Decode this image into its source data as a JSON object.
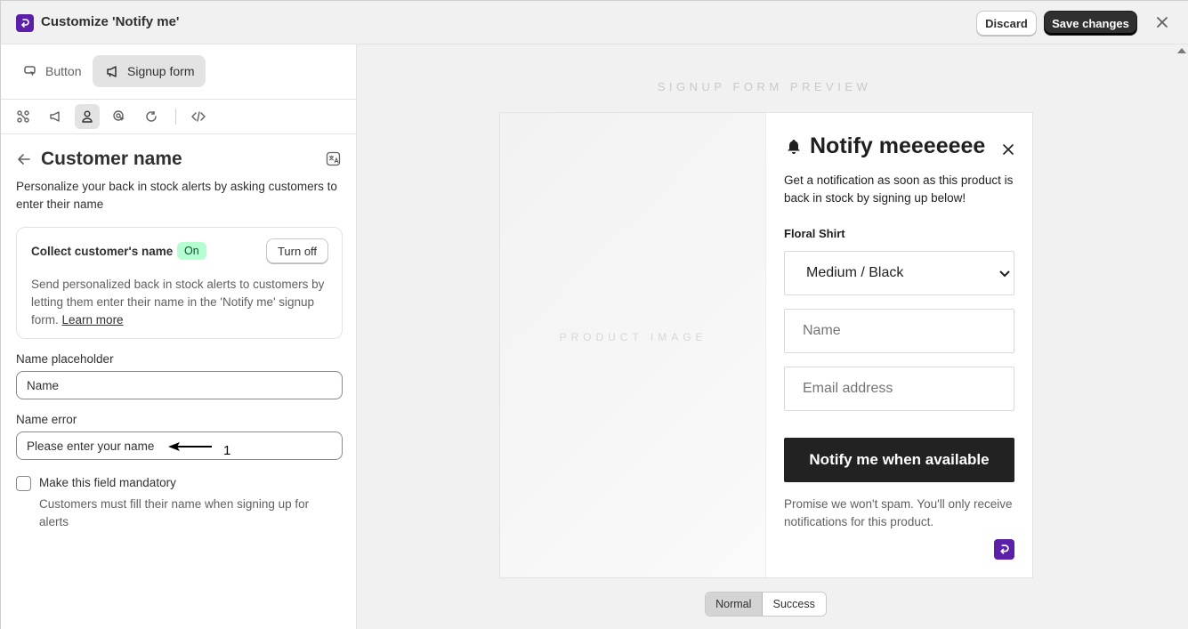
{
  "app": {
    "title": "Customize 'Notify me'",
    "discard_label": "Discard",
    "save_label": "Save changes"
  },
  "tabs": [
    {
      "label": "Button",
      "active": false
    },
    {
      "label": "Signup form",
      "active": true
    }
  ],
  "section": {
    "title": "Customer name",
    "description": "Personalize your back in stock alerts by asking customers to enter their name"
  },
  "collect_card": {
    "title": "Collect customer's name",
    "status": "On",
    "toggle_label": "Turn off",
    "description": "Send personalized back in stock alerts to customers by letting them enter their name in the 'Notify me' signup form.",
    "learn_more": "Learn more"
  },
  "fields": {
    "placeholder_label": "Name placeholder",
    "placeholder_value": "Name",
    "error_label": "Name error",
    "error_value": "Please enter your name"
  },
  "annotation": "1",
  "mandatory": {
    "label": "Make this field mandatory",
    "help": "Customers must fill their name when signing up for alerts",
    "checked": false
  },
  "preview": {
    "title": "SIGNUP FORM PREVIEW",
    "product_image_text": "PRODUCT IMAGE",
    "form_title": "Notify meeeeeee",
    "form_description": "Get a notification as soon as this product is back in stock by signing up below!",
    "product_name": "Floral Shirt",
    "variant": "Medium / Black",
    "name_placeholder": "Name",
    "email_placeholder": "Email address",
    "submit_label": "Notify me when available",
    "spam_note": "Promise we won't spam. You'll only receive notifications for this product."
  },
  "state_toggle": [
    {
      "label": "Normal",
      "active": true
    },
    {
      "label": "Success",
      "active": false
    }
  ],
  "colors": {
    "brand": "#5c1fa8",
    "badge_on_bg": "#b4fed2",
    "primary_button": "#303030",
    "preview_button": "#222222"
  }
}
